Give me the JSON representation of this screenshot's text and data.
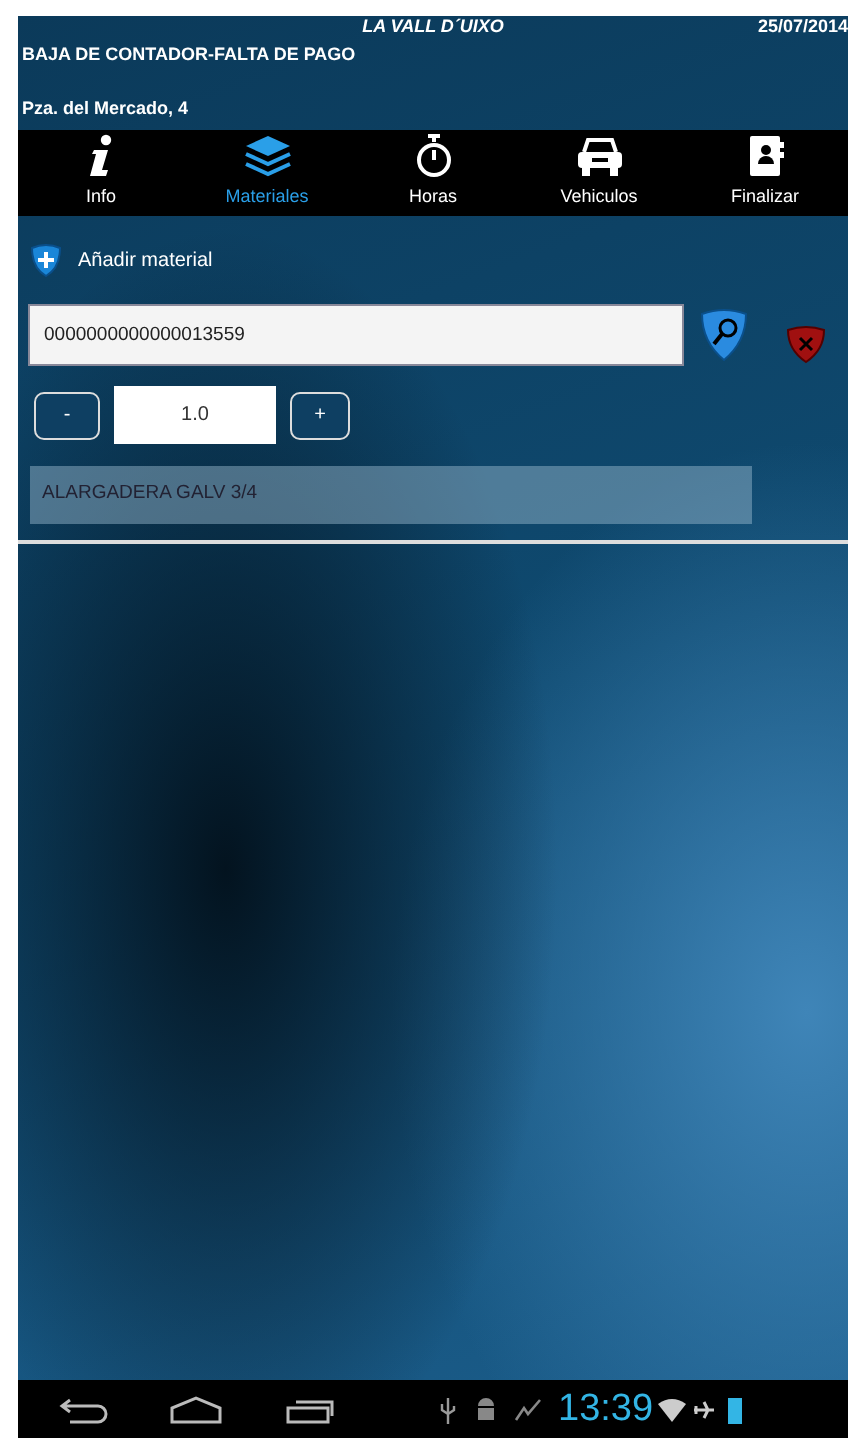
{
  "header": {
    "town": "LA VALL D´UIXO",
    "date": "25/07/2014",
    "title": "BAJA DE CONTADOR-FALTA DE PAGO",
    "address": "Pza. del Mercado, 4"
  },
  "tabs": [
    {
      "label": "Info",
      "kind": "info",
      "selected": false
    },
    {
      "label": "Materiales",
      "kind": "layers",
      "selected": true
    },
    {
      "label": "Horas",
      "kind": "stopwatch",
      "selected": false
    },
    {
      "label": "Vehiculos",
      "kind": "car",
      "selected": false
    },
    {
      "label": "Finalizar",
      "kind": "contact",
      "selected": false
    }
  ],
  "add_material": {
    "label": "Añadir material"
  },
  "code_field": {
    "value": "0000000000000013559"
  },
  "quantity": {
    "minus": "-",
    "value": "1.0",
    "plus": "+"
  },
  "results": [
    "ALARGADERA GALV 3/4"
  ],
  "status_bar": {
    "time": "13:39"
  }
}
